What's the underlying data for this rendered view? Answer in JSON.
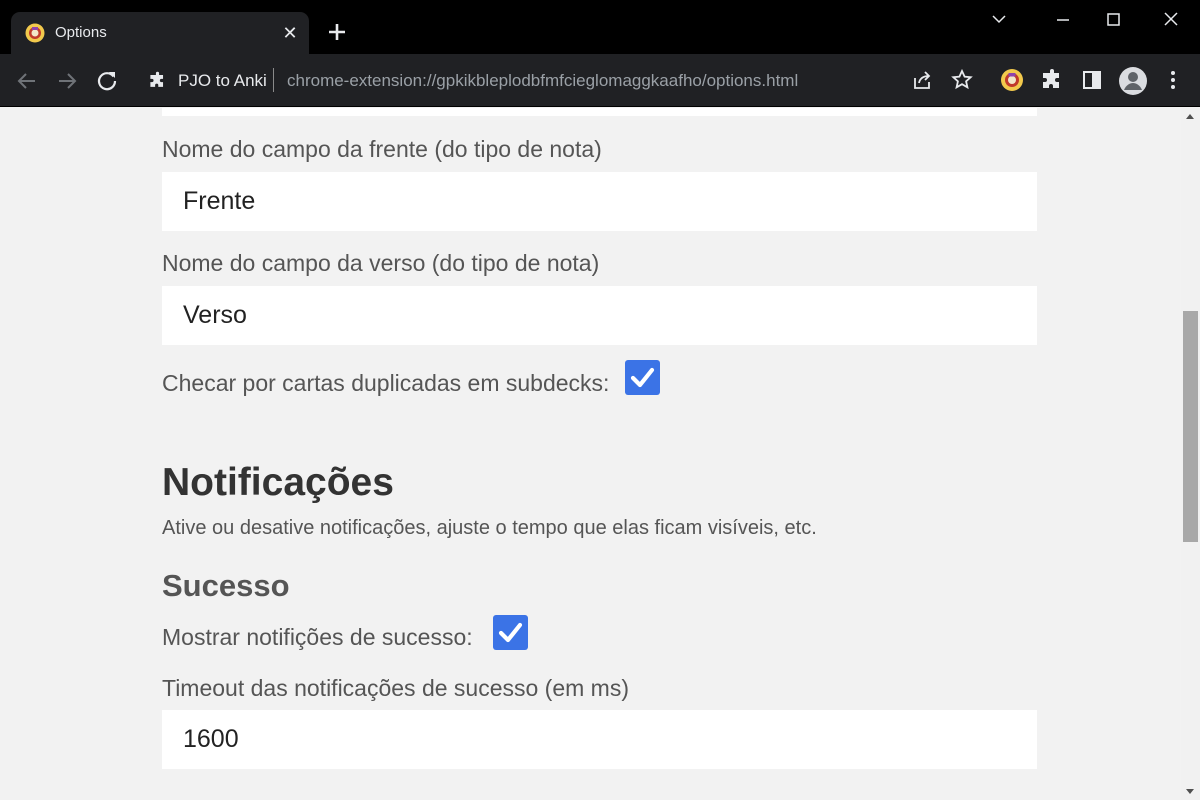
{
  "browser": {
    "tab": {
      "title": "Options",
      "favicon": "pjo-logo-icon"
    },
    "omnibox": {
      "extension_name": "PJO to Anki",
      "url": "chrome-extension://gpkikbleplodbfmfcieglomaggkaafho/options.html"
    },
    "toolbar_icons": [
      "share-icon",
      "star-icon",
      "pjo-extension-icon",
      "puzzle-icon",
      "side-panel-icon",
      "profile-icon",
      "more-icon"
    ]
  },
  "form": {
    "front_field": {
      "label": "Nome do campo da frente (do tipo de nota)",
      "value": "Frente"
    },
    "back_field": {
      "label": "Nome do campo da verso (do tipo de nota)",
      "value": "Verso"
    },
    "check_duplicates": {
      "label": "Checar por cartas duplicadas em subdecks:",
      "checked": true
    }
  },
  "notifications": {
    "title": "Notificações",
    "description": "Ative ou desative notificações, ajuste o tempo que elas ficam visíveis, etc.",
    "success": {
      "title": "Sucesso",
      "show_label": "Mostrar notifições de sucesso:",
      "show_checked": true,
      "timeout_label": "Timeout das notificações de sucesso (em ms)",
      "timeout_value": "1600"
    }
  },
  "colors": {
    "checkbox": "#3b73e6",
    "chrome_dark": "#202124"
  }
}
